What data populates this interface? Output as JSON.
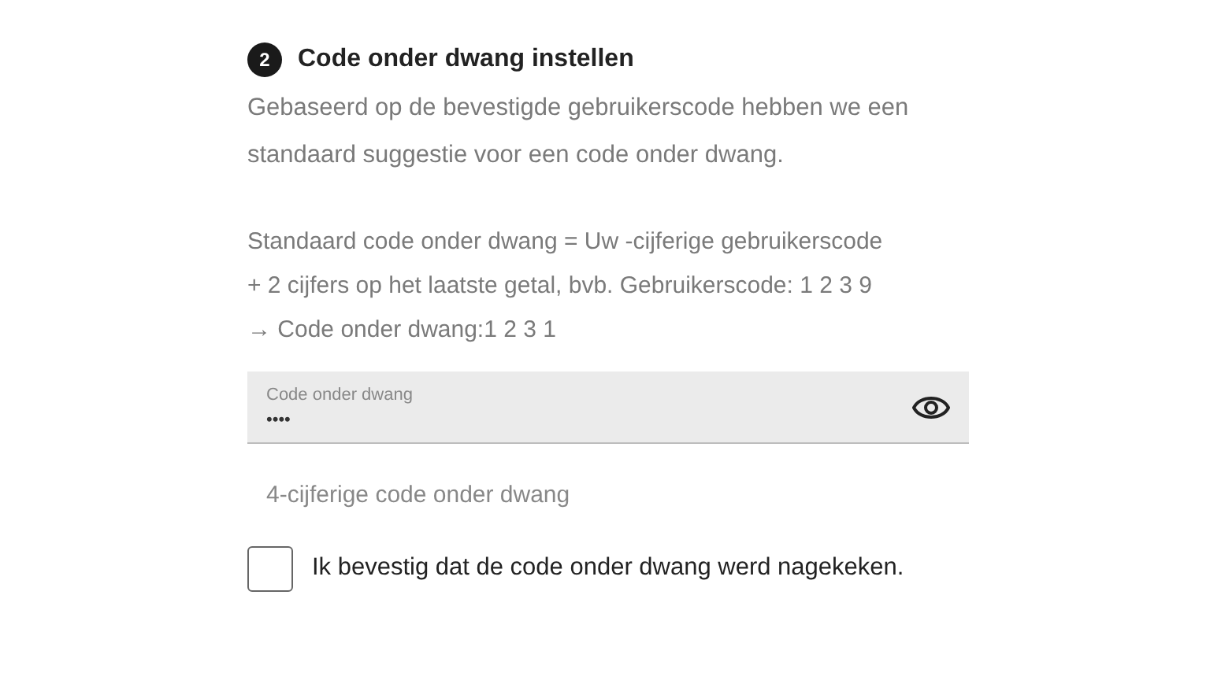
{
  "step": {
    "number": "2",
    "title": "Code onder dwang instellen"
  },
  "intro": "Gebaseerd op de bevestigde gebruikerscode hebben we een standaard suggestie voor een code onder dwang.",
  "explanation": [
    "Standaard code onder dwang = Uw -cijferige gebruikerscode",
    "+ 2 cijfers op het laatste getal, bvb. Gebruikerscode: 1 2 3 9",
    "→ Code onder dwang:1 2 3 1"
  ],
  "field": {
    "label": "Code onder dwang",
    "value": "••••",
    "helper": "4-cijferige code onder dwang"
  },
  "confirm": {
    "label": "Ik bevestig dat de code onder dwang werd nagekeken.",
    "checked": false
  }
}
